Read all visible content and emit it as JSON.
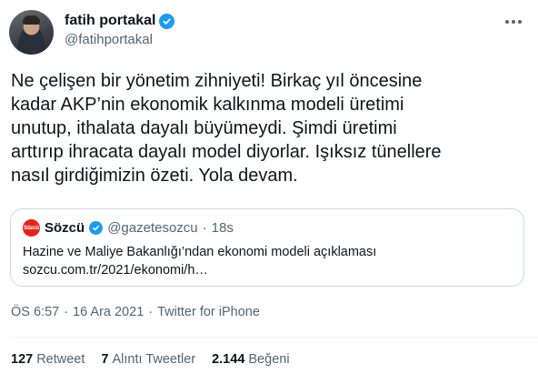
{
  "author": {
    "display_name": "fatih portakal",
    "handle": "@fatihportakal",
    "verified": true
  },
  "tweet": {
    "text": "Ne çelişen bir yönetim zihniyeti! Birkaç yıl öncesine\nkadar AKP’nin ekonomik kalkınma modeli üretimi\nunutup, ithalata dayalı büyümeydi. Şimdi üretimi\narttırıp ihracata dayalı model diyorlar. Işıksız tünellere\nnasıl girdiğimizin özeti. Yola devam."
  },
  "quote": {
    "avatar_text": "Sözcü",
    "name": "Sözcü",
    "handle": "@gazetesozcu",
    "dot": "·",
    "time": "18s",
    "text": "Hazine ve Maliye Bakanlığı’ndan ekonomi modeli açıklaması\nsozcu.com.tr/2021/ekonomi/h…"
  },
  "meta": {
    "time": "ÖS 6:57",
    "sep1": "·",
    "date": "16 Ara 2021",
    "sep2": "·",
    "source": "Twitter for iPhone"
  },
  "stats": {
    "retweets_count": "127",
    "retweets_label": "Retweet",
    "quotes_count": "7",
    "quotes_label": "Alıntı Tweetler",
    "likes_count": "2.144",
    "likes_label": "Beğeni"
  },
  "colors": {
    "accent": "#1d9bf0",
    "secondary_text": "#536471",
    "brand_sozcu": "#e0251b"
  }
}
